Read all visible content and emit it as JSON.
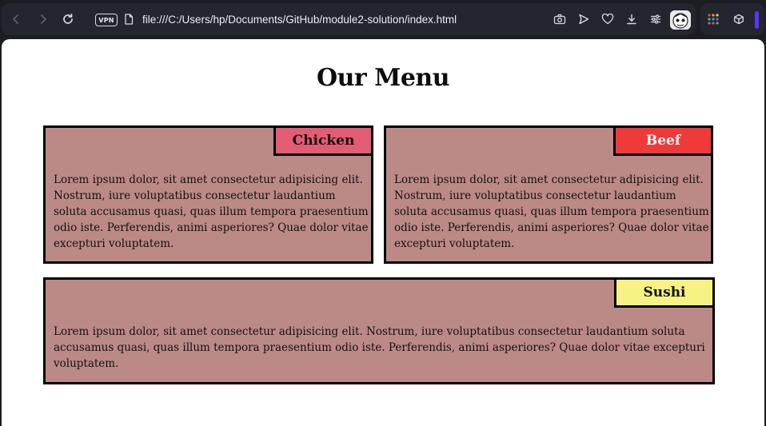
{
  "browser": {
    "url": "file:///C:/Users/hp/Documents/GitHub/module2-solution/index.html",
    "vpn_label": "VPN",
    "accent_color": "#5b34f5"
  },
  "page": {
    "title": "Our Menu",
    "sections": [
      {
        "label": "Chicken",
        "label_bg": "#e45b74",
        "label_color": "#111111",
        "text": "Lorem ipsum dolor, sit amet consectetur adipisicing elit. Nostrum, iure voluptatibus consectetur laudantium soluta accusamus quasi, quas illum tempora praesentium odio iste. Perferendis, animi asperiores? Quae dolor vitae excepturi voluptatem."
      },
      {
        "label": "Beef",
        "label_bg": "#f03a3a",
        "label_color": "#ffffff",
        "text": "Lorem ipsum dolor, sit amet consectetur adipisicing elit. Nostrum, iure voluptatibus consectetur laudantium soluta accusamus quasi, quas illum tempora praesentium odio iste. Perferendis, animi asperiores? Quae dolor vitae excepturi voluptatem."
      },
      {
        "label": "Sushi",
        "label_bg": "#f6f384",
        "label_color": "#111111",
        "text": "Lorem ipsum dolor, sit amet consectetur adipisicing elit. Nostrum, iure voluptatibus consectetur laudantium soluta accusamus quasi, quas illum tempora praesentium odio iste. Perferendis, animi asperiores? Quae dolor vitae excepturi voluptatem."
      }
    ],
    "section_bg": "#bc8a86"
  }
}
